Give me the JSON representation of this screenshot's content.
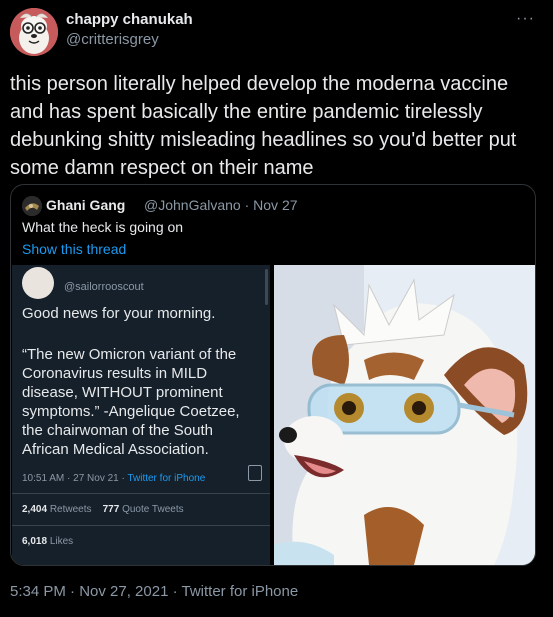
{
  "author": {
    "display_name": "chappy chanukah",
    "handle": "@critterisgrey"
  },
  "more_label": "···",
  "tweet_text": "this person literally helped develop the moderna vaccine and has spent basically the entire pandemic tirelessly debunking shitty misleading headlines so you'd better put some damn respect on their name",
  "quoted": {
    "display_name": "Ghani Gang",
    "handle_date": "@JohnGalvano · Nov 27",
    "text": "What the heck is going on",
    "show_thread": "Show this thread",
    "screenshot": {
      "handle": "@sailorrooscout",
      "good_news": "Good news for your morning.",
      "quote": "“The new Omicron variant of the Coronavirus results in MILD disease, WITHOUT prominent symptoms.” -Angelique Coetzee, the chairwoman of the South African Medical Association.",
      "time": "10:51 AM · 27 Nov 21 · ",
      "source": "Twitter for iPhone",
      "retweets_count": "2,404",
      "retweets_label": "Retweets",
      "quote_count": "777",
      "quote_label": "Quote Tweets",
      "likes_count": "6,018",
      "likes_label": "Likes"
    }
  },
  "footer": "5:34 PM · Nov 27, 2021 · Twitter for iPhone",
  "colors": {
    "background": "#000000",
    "link": "#1d9bf0",
    "secondary_text": "#8b98a5"
  }
}
